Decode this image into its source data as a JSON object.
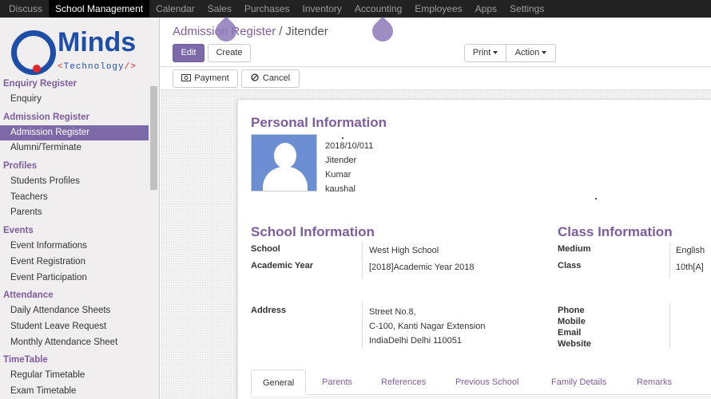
{
  "topnav": {
    "items": [
      "Discuss",
      "School Management",
      "Calendar",
      "Sales",
      "Purchases",
      "Inventory",
      "Accounting",
      "Employees",
      "Apps",
      "Settings"
    ],
    "active_index": 1
  },
  "logo": {
    "brand": "Minds",
    "tagline_open": "<",
    "tagline_text": "Technology",
    "tagline_close": "/>"
  },
  "sidebar": {
    "sections": [
      {
        "title": "Enquiry Register",
        "items": [
          "Enquiry"
        ]
      },
      {
        "title": "Admission Register",
        "items": [
          "Admission Register",
          "Alumni/Terminate"
        ]
      },
      {
        "title": "Profiles",
        "items": [
          "Students Profiles",
          "Teachers",
          "Parents"
        ]
      },
      {
        "title": "Events",
        "items": [
          "Event Informations",
          "Event Registration",
          "Event Participation"
        ]
      },
      {
        "title": "Attendance",
        "items": [
          "Daily Attendance Sheets",
          "Student Leave Request",
          "Monthly Attendance Sheet"
        ]
      },
      {
        "title": "TimeTable",
        "items": [
          "Regular Timetable",
          "Exam Timetable"
        ]
      }
    ],
    "active_item": "Admission Register"
  },
  "breadcrumb": {
    "parent": "Admission Register",
    "separator": "/",
    "current": "Jitender"
  },
  "toolbar": {
    "edit": "Edit",
    "create": "Create",
    "print": "Print",
    "action": "Action"
  },
  "statusbar": {
    "payment": "Payment",
    "cancel": "Cancel"
  },
  "form": {
    "personal_title": "Personal Information",
    "personal": {
      "date": "2018/10/011",
      "first_name": "Jitender",
      "middle_name": "Kumar",
      "last_name": "kaushal"
    },
    "school_title": "School Information",
    "school": {
      "school_label": "School",
      "school_value": "West High School",
      "year_label": "Academic Year",
      "year_value": "[2018]Academic Year 2018"
    },
    "class_title": "Class Information",
    "class_info": {
      "medium_label": "Medium",
      "medium_value": "English",
      "class_label": "Class",
      "class_value": "10th[A]"
    },
    "address_label": "Address",
    "address_lines": [
      "Street No.8,",
      "C-100, Kanti Nagar Extension",
      "IndiaDelhi Delhi 110051"
    ],
    "contact_labels": [
      "Phone",
      "Mobile",
      "Email",
      "Website"
    ]
  },
  "tabs": [
    "General",
    "Parents",
    "References",
    "Previous School",
    "Family Details",
    "Remarks"
  ],
  "colors": {
    "accent": "#7c5d9f",
    "primary_button": "#7c6aa8",
    "topbar": "#222222",
    "logo_blue": "#1f4ea8",
    "logo_red": "#e02727"
  }
}
